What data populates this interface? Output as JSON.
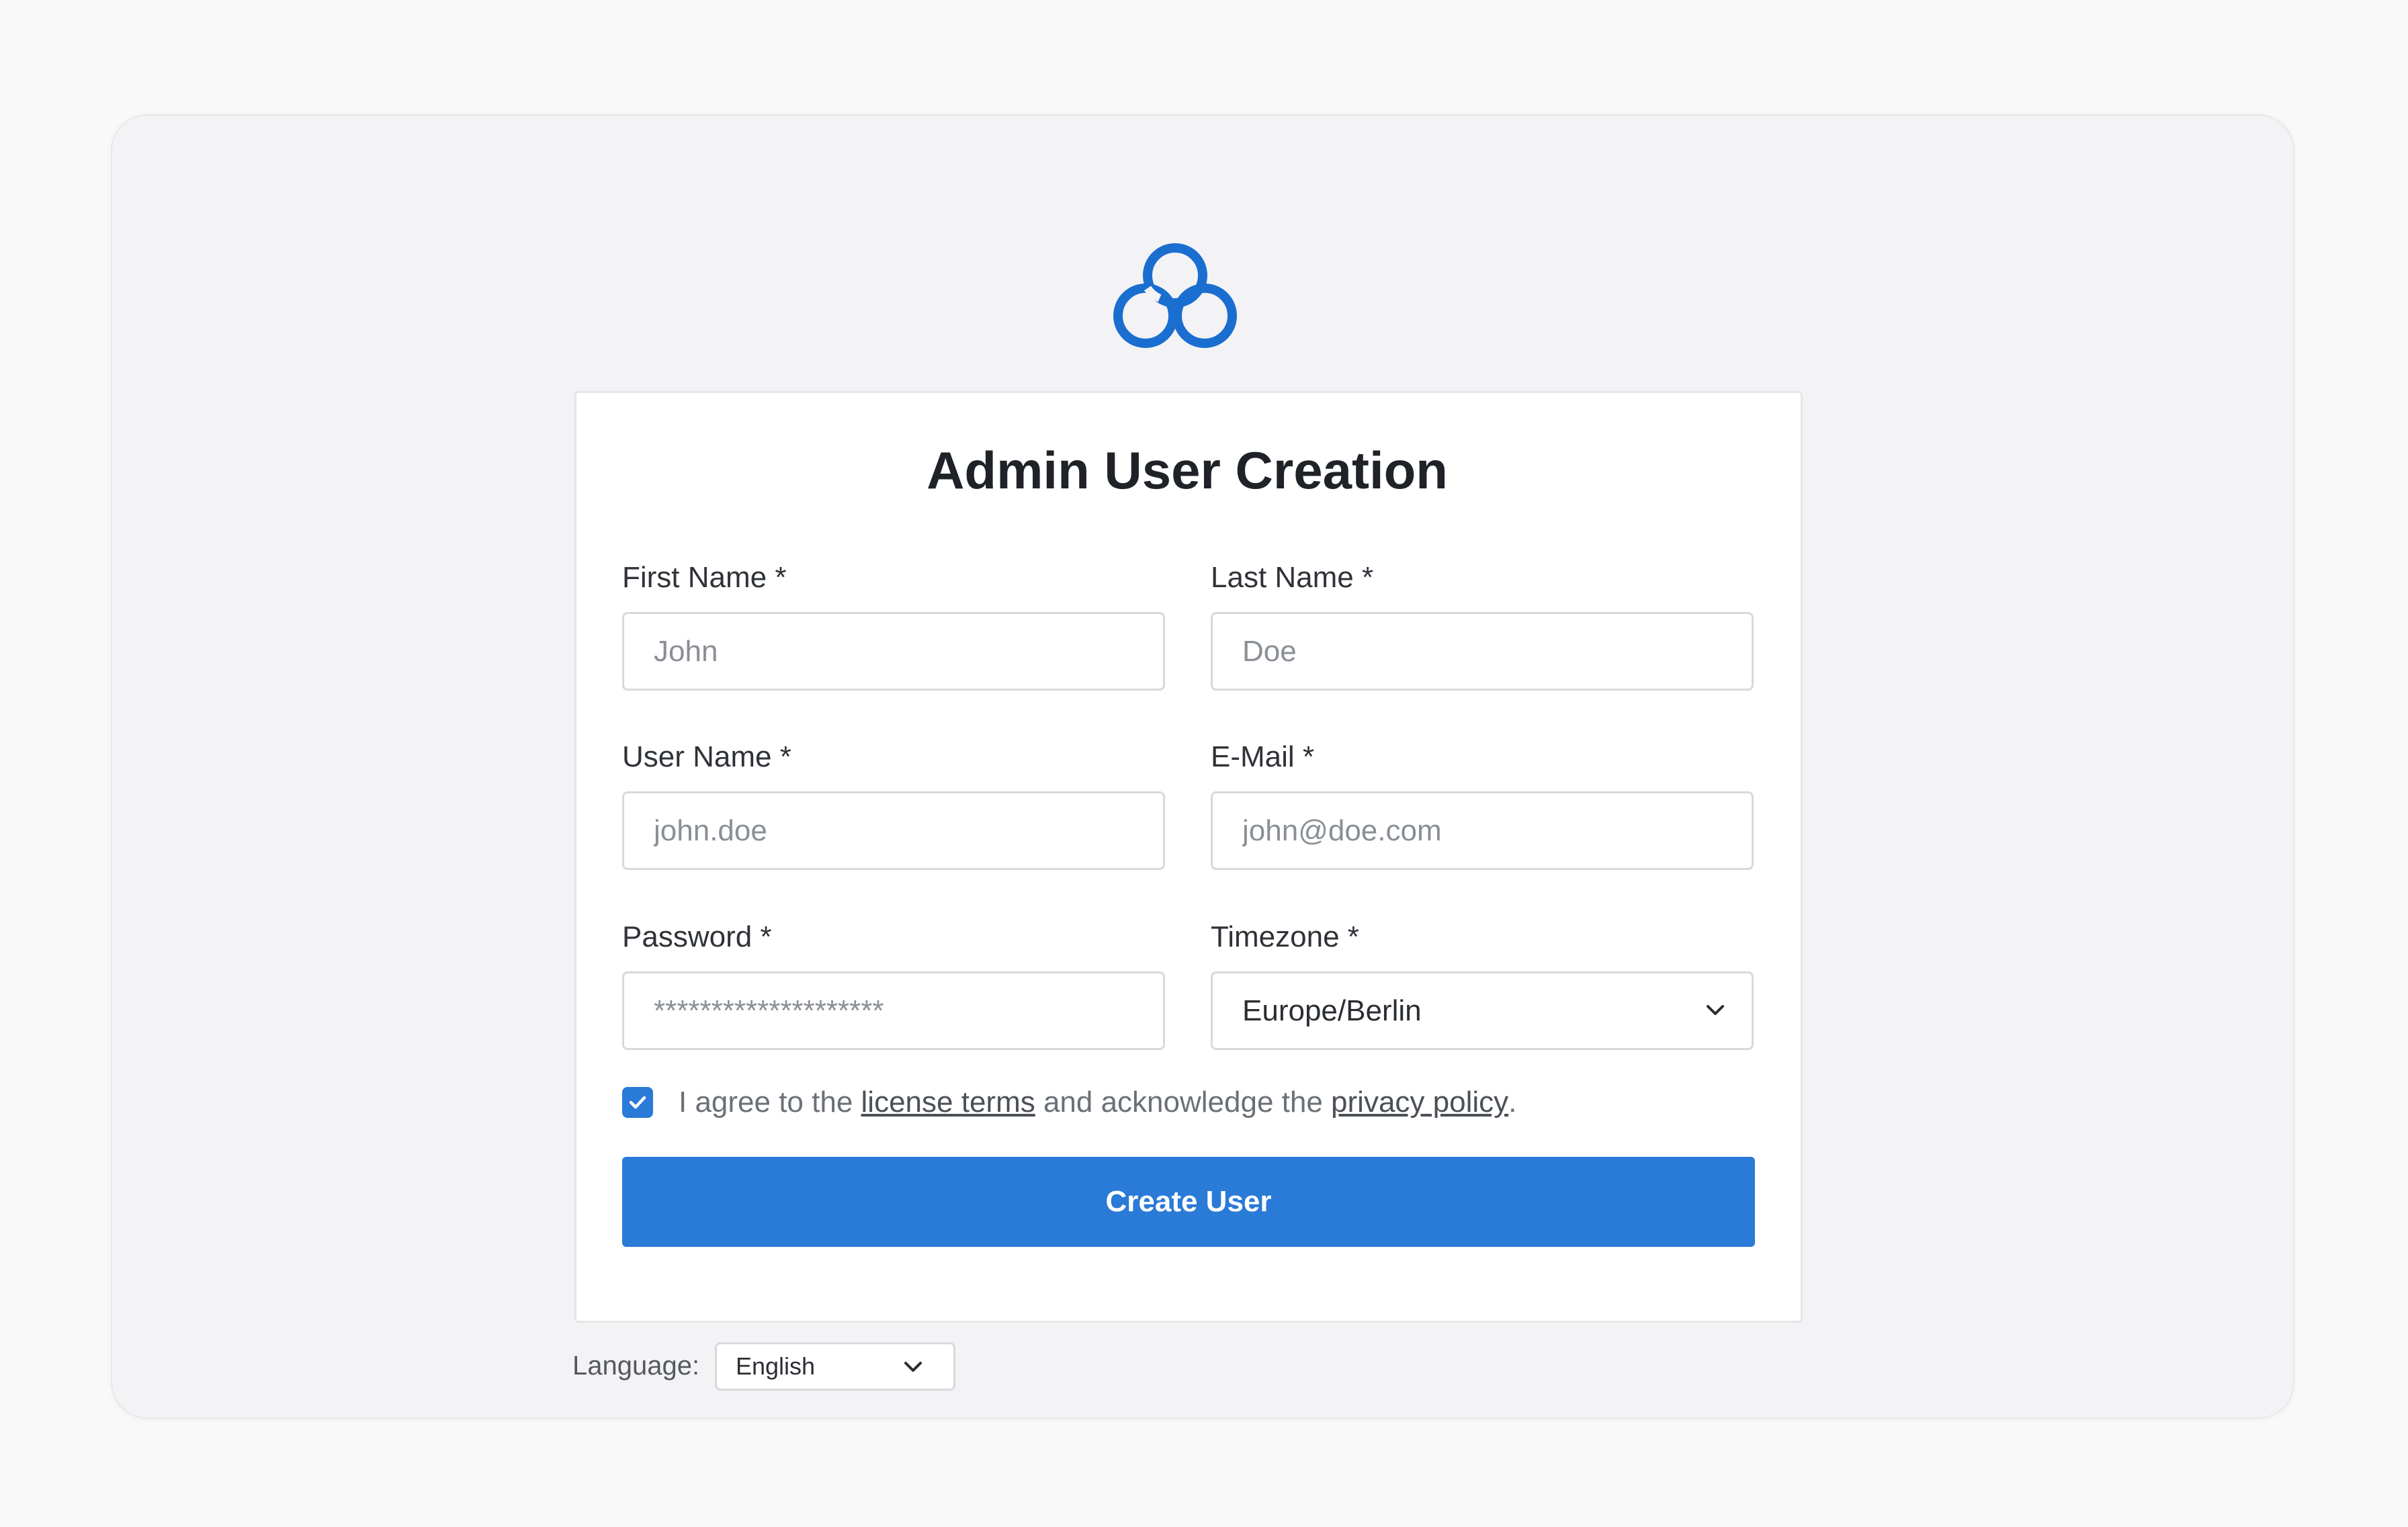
{
  "brand": {
    "logo_icon": "cloud-logo-icon",
    "accent_color": "#2a7ad7"
  },
  "form": {
    "title": "Admin User Creation",
    "first_name": {
      "label": "First Name *",
      "placeholder": "John"
    },
    "last_name": {
      "label": "Last Name *",
      "placeholder": "Doe"
    },
    "user_name": {
      "label": "User Name *",
      "placeholder": "john.doe"
    },
    "email": {
      "label": "E-Mail *",
      "placeholder": "john@doe.com"
    },
    "password": {
      "label": "Password *",
      "placeholder": "********************"
    },
    "timezone": {
      "label": "Timezone *",
      "value": "Europe/Berlin",
      "icon": "chevron-down-icon"
    },
    "agreement": {
      "checked": true,
      "prefix": "I agree to the ",
      "license_link": "license terms",
      "middle": " and acknowledge the ",
      "privacy_link": "privacy policy",
      "suffix": "."
    },
    "submit_label": "Create User"
  },
  "footer": {
    "language_label": "Language:",
    "language_value": "English",
    "language_icon": "chevron-down-icon"
  }
}
